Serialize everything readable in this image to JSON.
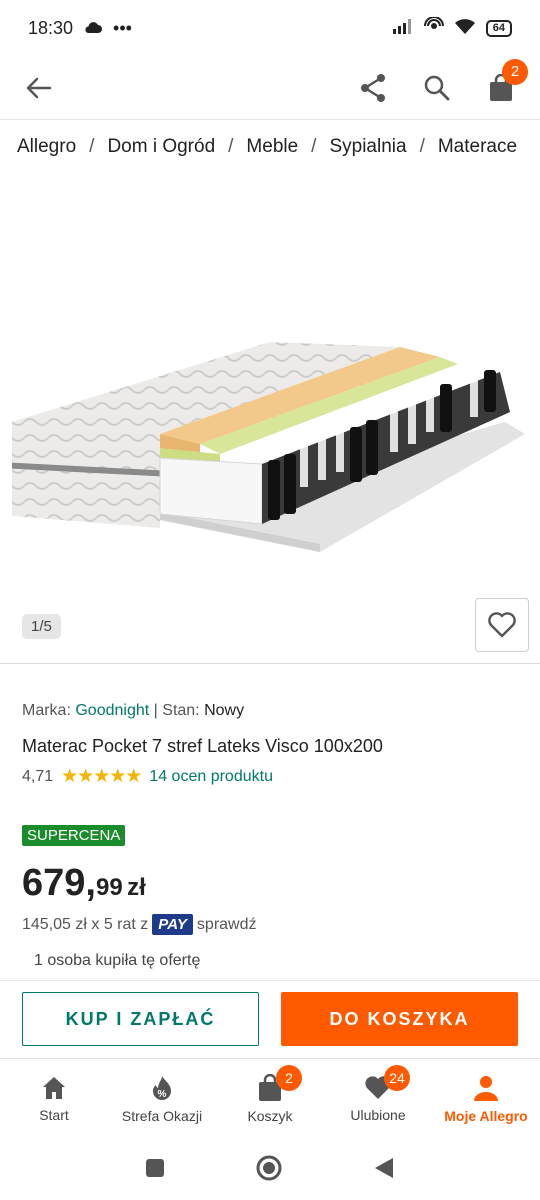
{
  "status_bar": {
    "time": "18:30",
    "battery": "64"
  },
  "header": {
    "cart_count": "2"
  },
  "breadcrumb": [
    "Allegro",
    "Dom i Ogród",
    "Meble",
    "Sypialnia",
    "Materace"
  ],
  "gallery": {
    "counter": "1/5"
  },
  "product": {
    "brand_label": "Marka:",
    "brand": "Goodnight",
    "separator": "|",
    "condition_label": "Stan:",
    "condition": "Nowy",
    "title": "Materac Pocket 7 stref Lateks Visco 100x200",
    "rating_value": "4,71",
    "stars": "★★★★★",
    "rating_count": "14 ocen produktu",
    "badge": "SUPERCENA",
    "price_int": "679,",
    "price_dec": "99",
    "price_cur": "zł",
    "installments_text": "145,05 zł x 5 rat z",
    "pay_logo": "PAY",
    "installments_link": "sprawdź",
    "buyers": "1 osoba kupiła tę ofertę"
  },
  "actions": {
    "buy": "KUP I ZAPŁAĆ",
    "cart": "DO KOSZYKA"
  },
  "bottom_nav": [
    {
      "label": "Start"
    },
    {
      "label": "Strefa Okazji"
    },
    {
      "label": "Koszyk",
      "badge": "2"
    },
    {
      "label": "Ulubione",
      "badge": "24"
    },
    {
      "label": "Moje Allegro"
    }
  ],
  "colors": {
    "accent": "#ff5a00",
    "link": "#00796b",
    "supercena": "#1a8c2b",
    "pay": "#1e3a8a"
  }
}
